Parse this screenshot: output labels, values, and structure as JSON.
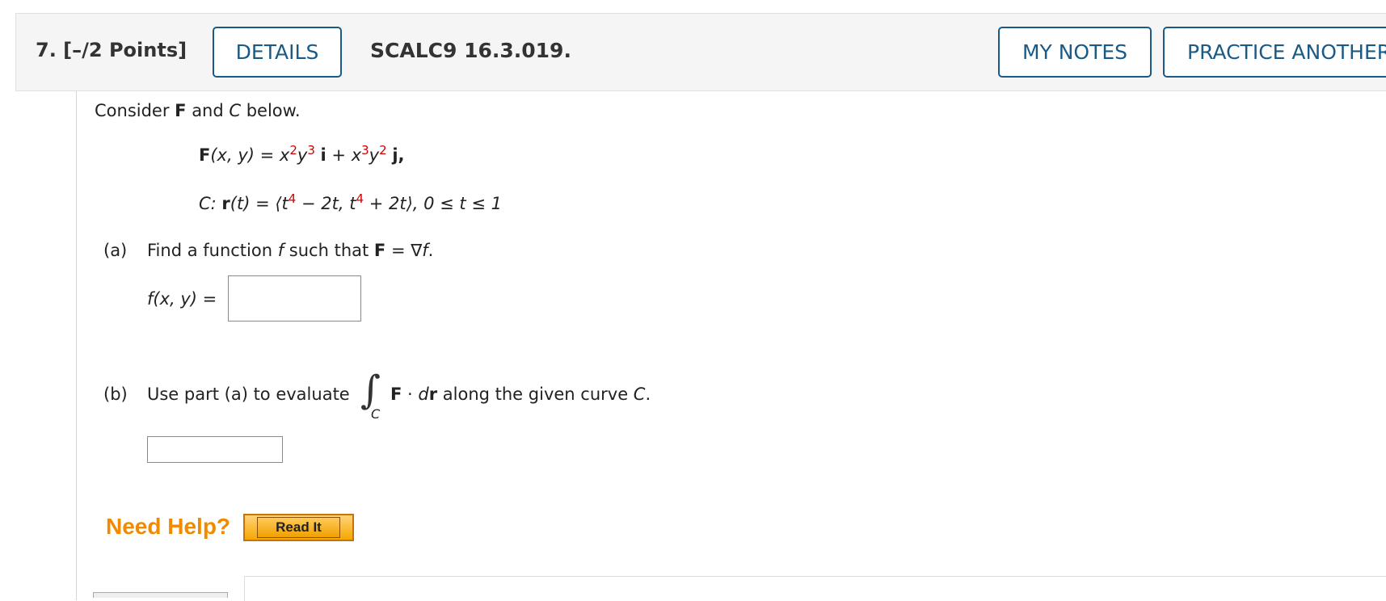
{
  "header": {
    "question_label": "7.  [–/2 Points]",
    "details_label": "DETAILS",
    "problem_code": "SCALC9 16.3.019.",
    "my_notes_label": "MY NOTES",
    "practice_label": "PRACTICE ANOTHER"
  },
  "problem": {
    "intro_a": "Consider ",
    "intro_F": "F",
    "intro_b": " and ",
    "intro_C": "C",
    "intro_c": " below.",
    "F_def": {
      "lhs_bold": "F",
      "lhs_args": "(x, y) = x",
      "exp1": "2",
      "y1": "y",
      "exp2": "3",
      "i": "i",
      "plus": " + x",
      "exp3": "3",
      "y2": "y",
      "exp4": "2",
      "j": "j",
      "end": ","
    },
    "C_def": {
      "c_label": "C: ",
      "r": "r",
      "paren": "(t) = ",
      "open": "⟨t",
      "exp1": "4",
      "mid": " − 2t, t",
      "exp2": "4",
      "close": " + 2t⟩,  0 ≤ t ≤ 1"
    },
    "part_a": {
      "label": "(a)",
      "text1": "Find a function ",
      "f": "f",
      "text2": " such that ",
      "F": "F",
      "text3": " = ∇",
      "f2": "f",
      "text4": ".",
      "answer_prefix": "f(x, y) ="
    },
    "part_b": {
      "label": "(b)",
      "text1": "Use part (a) to evaluate",
      "integral_sub": "C",
      "F": "F",
      "dot": " · ",
      "d": "d",
      "r": "r",
      "text2": " along the given curve ",
      "C": "C",
      "text3": "."
    }
  },
  "help": {
    "need_help": "Need Help?",
    "read_it": "Read It"
  },
  "colors": {
    "accent": "#1a5a86",
    "exponent_red": "#cc0000",
    "need_help_orange": "#f08a00"
  }
}
